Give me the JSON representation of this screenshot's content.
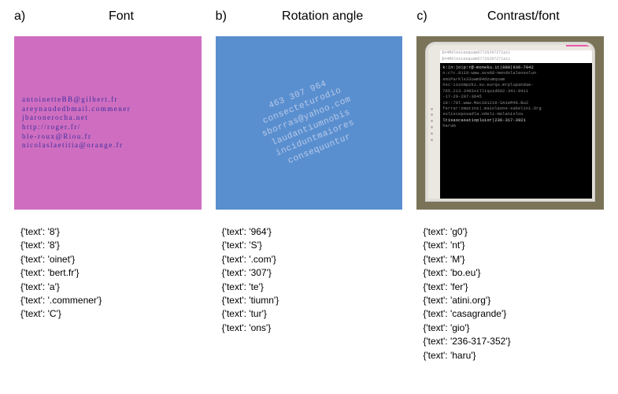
{
  "columns": {
    "a": {
      "label": "a)",
      "title": "Font",
      "lines": [
        "antoinetteBB@gilbert.fr",
        "areynaudedbmail.commener",
        "jbaronerocha.net",
        "http://roger.fr/",
        "ble-roux@Riou.fr",
        "nicolaslaetitia@orange.fr"
      ],
      "output": [
        "{'text': '8'}",
        "{'text': '8'}",
        "{'text': 'oinet'}",
        "{'text': 'bert.fr'}",
        "{'text': 'a'}",
        "{'text': '.commener'}",
        "{'text': 'C'}"
      ]
    },
    "b": {
      "label": "b)",
      "title": "Rotation angle",
      "lines": [
        "463 307 964",
        "consecteturodio",
        "sborras@yahoo.com",
        "laudantiumnobis",
        "inciduntmaiores",
        "consequuntur"
      ],
      "output": [
        "{'text': '964'}",
        "{'text': 'S'}",
        "{'text': '.com'}",
        "{'text': '307'}",
        "{'text': 'te'}",
        "{'text': 'tiumn'}",
        "{'text': 'tur'}",
        "{'text': 'ons'}"
      ]
    },
    "c": {
      "label": "c)",
      "title": "Contrast/font",
      "screen_top1": "$#4M0les1asquam87726297271aii",
      "screen_top2": "$#4M0les1asquam87726297271aii",
      "terminal_lines": [
        "k:(n:)o|p:r@-moneku.it|888|936-7042",
        "n:c?c.8118-www.avs88-mendolaleosolun",
        "emiParkls33uwm94dzumquam",
        "hsc-iisompzki.su.eurqu.mrplupandae-",
        "765.213.3493xilliquid602-341-8411",
        "-17-20-207-3645",
        "i8::78l.www.Maci81210-SA1eM40.Bu2",
        "ferrar:omatins|.maiolaone-sabelini.Org",
        "solisceposadla.odeli-melanislou",
        "ltisascasatiopluior|236-317-3921",
        "harum"
      ],
      "output": [
        "{'text': 'g0'}",
        "{'text': 'nt'}",
        "{'text': 'M'}",
        "{'text': 'bo.eu'}",
        "{'text': 'fer'}",
        "{'text': 'atini.org'}",
        "{'text': 'casagrande'}",
        "{'text': 'gio'}",
        "{'text': '236-317-352'}",
        "{'text': 'haru'}"
      ]
    }
  }
}
